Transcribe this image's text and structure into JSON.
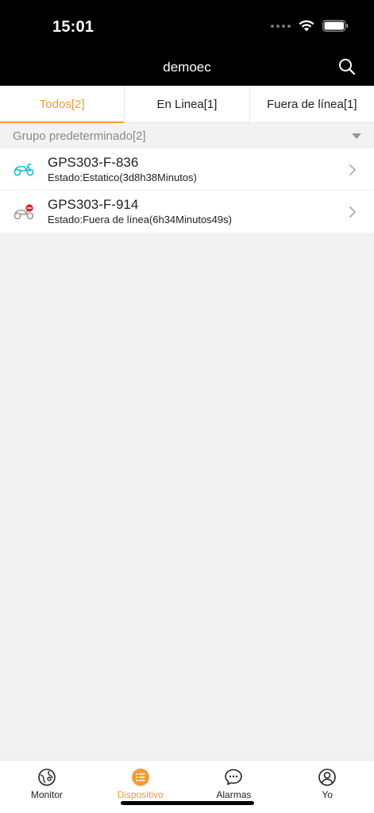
{
  "status_bar": {
    "time": "15:01"
  },
  "header": {
    "title": "demoec"
  },
  "tabs": [
    {
      "label": "Todos[2]",
      "active": true
    },
    {
      "label": "En Linea[1]",
      "active": false
    },
    {
      "label": "Fuera de línea[1]",
      "active": false
    }
  ],
  "group": {
    "label": "Grupo predeterminado[2]"
  },
  "devices": [
    {
      "name": "GPS303-F-836",
      "status": "Estado:Estatico(3d8h38Minutos)",
      "icon": "scooter-online-icon"
    },
    {
      "name": "GPS303-F-914",
      "status": "Estado:Fuera de línea(6h34Minutos49s)",
      "icon": "scooter-offline-icon"
    }
  ],
  "bottom_nav": [
    {
      "label": "Monitor",
      "active": false
    },
    {
      "label": "Dispositivo",
      "active": true
    },
    {
      "label": "Alarmas",
      "active": false
    },
    {
      "label": "Yo",
      "active": false
    }
  ],
  "colors": {
    "accent": "#f19c38",
    "online": "#1fb6d6",
    "offline": "#9a9a9a",
    "offline_badge": "#e02020"
  }
}
